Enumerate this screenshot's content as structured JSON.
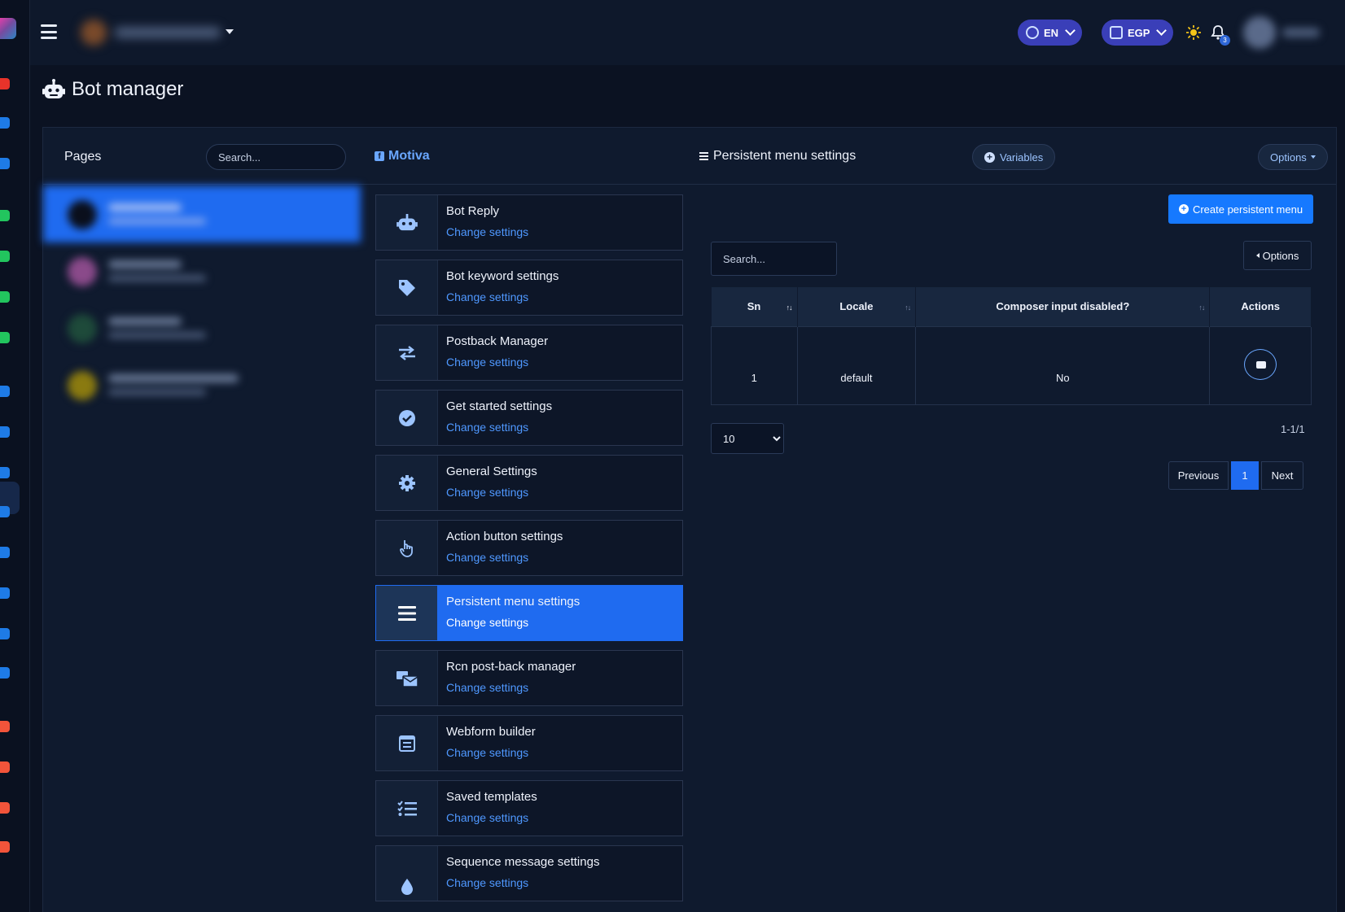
{
  "topbar": {
    "language": "EN",
    "currency": "EGP",
    "notification_count": "3"
  },
  "page": {
    "title": "Bot manager"
  },
  "pages_panel": {
    "label": "Pages",
    "search_placeholder": "Search..."
  },
  "selected_page": {
    "name": "Motiva"
  },
  "section": {
    "title": "Persistent menu settings",
    "variables_label": "Variables",
    "options_label": "Options"
  },
  "menu": [
    {
      "name": "Bot Reply",
      "link": "Change settings",
      "icon": "robot-icon"
    },
    {
      "name": "Bot keyword settings",
      "link": "Change settings",
      "icon": "tag-icon"
    },
    {
      "name": "Postback Manager",
      "link": "Change settings",
      "icon": "exchange-icon"
    },
    {
      "name": "Get started settings",
      "link": "Change settings",
      "icon": "check-circle-icon"
    },
    {
      "name": "General Settings",
      "link": "Change settings",
      "icon": "gear-icon"
    },
    {
      "name": "Action button settings",
      "link": "Change settings",
      "icon": "hand-pointer-icon"
    },
    {
      "name": "Persistent menu settings",
      "link": "Change settings",
      "icon": "bars-icon",
      "active": true
    },
    {
      "name": "Rcn post-back manager",
      "link": "Change settings",
      "icon": "mail-bulk-icon"
    },
    {
      "name": "Webform builder",
      "link": "Change settings",
      "icon": "form-icon"
    },
    {
      "name": "Saved templates",
      "link": "Change settings",
      "icon": "tasks-icon"
    },
    {
      "name": "Sequence message settings",
      "link": "Change settings",
      "icon": "droplet-icon"
    }
  ],
  "table_panel": {
    "create_label": "Create persistent menu",
    "search_placeholder": "Search...",
    "options_label": "Options",
    "columns": [
      "Sn",
      "Locale",
      "Composer input disabled?",
      "Actions"
    ],
    "rows": [
      {
        "sn": "1",
        "locale": "default",
        "composer_disabled": "No"
      }
    ],
    "per_page": "10",
    "page_info": "1-1/1",
    "pagination": {
      "previous": "Previous",
      "current": "1",
      "next": "Next"
    }
  },
  "colors": {
    "accent": "#1f6bf0",
    "link": "#4f98ff",
    "pill": "#3a3fb8",
    "background": "#0b1222"
  }
}
